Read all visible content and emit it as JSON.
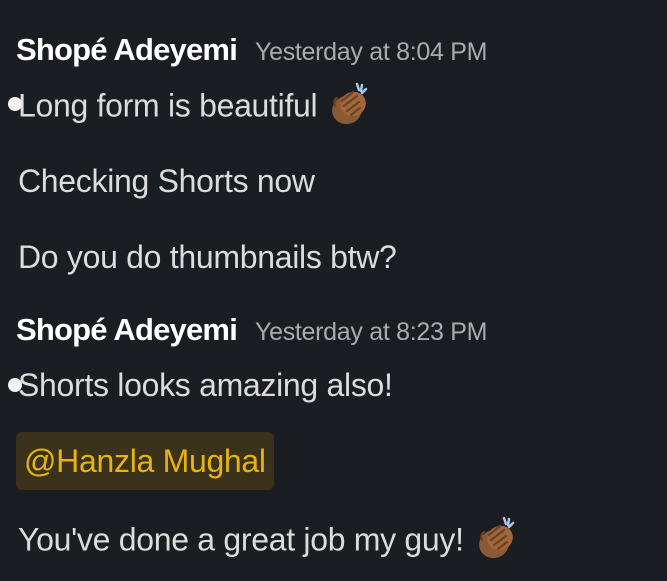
{
  "messages": [
    {
      "author": "Shopé Adeyemi",
      "timestamp": "Yesterday at 8:04 PM",
      "lines": [
        {
          "text": "Long form is beautiful",
          "emoji": "clapping-hands-icon"
        },
        {
          "text": "Checking Shorts now"
        },
        {
          "text": "Do you do thumbnails btw?"
        }
      ]
    },
    {
      "author": "Shopé Adeyemi",
      "timestamp": "Yesterday at 8:23 PM",
      "lines": [
        {
          "text": "Shorts looks amazing also!"
        },
        {
          "mention": "@Hanzla Mughal"
        },
        {
          "text": "You've done a great job my guy!",
          "emoji": "clapping-hands-icon"
        }
      ]
    }
  ],
  "colors": {
    "background": "#1a1d21",
    "author": "#ffffff",
    "timestamp": "#aaabad",
    "text": "#dcdcdd",
    "mention_text": "#e8b30c",
    "mention_bg": "#3a321b"
  }
}
